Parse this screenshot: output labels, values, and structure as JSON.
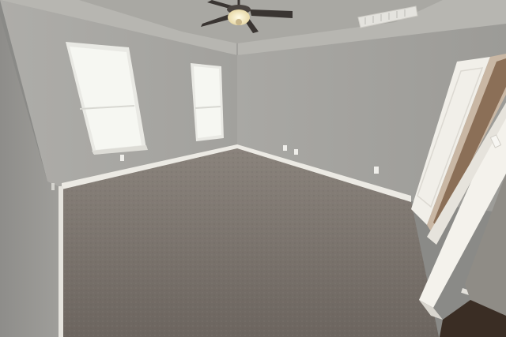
{
  "scene": {
    "subject": "empty-bedroom-interior",
    "colors": {
      "wall": "#aaa9a5",
      "wall_shadow": "#8f8e8b",
      "ceiling": "#b7b6b1",
      "carpet": "#7a736c",
      "trim": "#eceae4",
      "window_glass": "#f3f4ef",
      "door": "#f1efe9",
      "fan_blade": "#3a3532",
      "fan_light": "#fff2cc"
    },
    "icons": [
      "ceiling-fan-icon",
      "window-icon",
      "door-icon",
      "outlet-icon",
      "light-switch-icon",
      "air-vent-icon"
    ]
  }
}
